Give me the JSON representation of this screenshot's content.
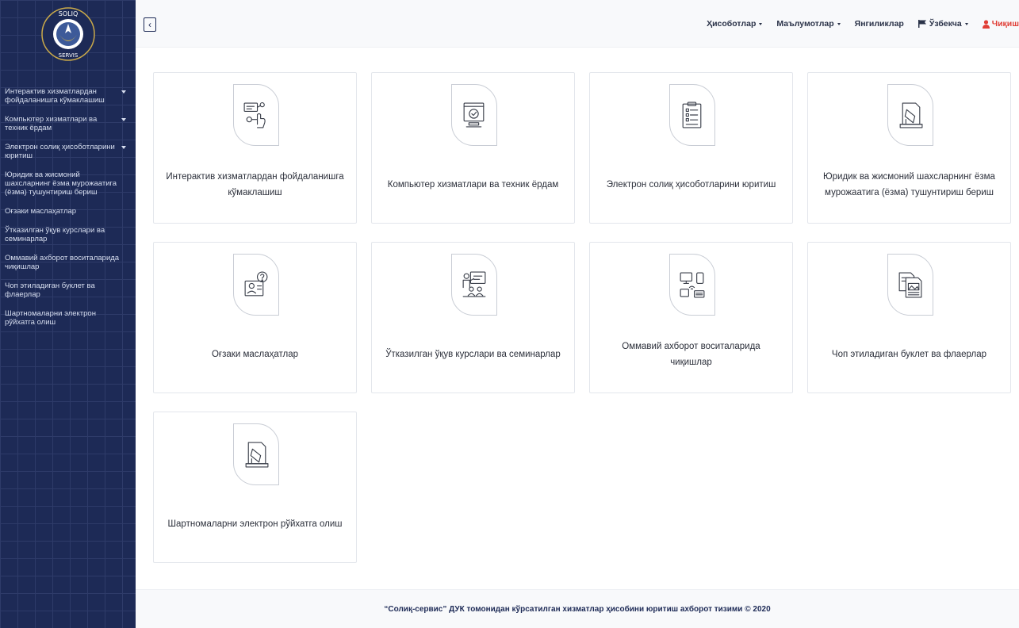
{
  "sidebar": {
    "logo": {
      "top_text": "SOLIQ",
      "bottom_text": "SERVIS"
    },
    "items": [
      {
        "label": "Интерактив хизматлардан фойдаланишга кўмаклашиш",
        "has_submenu": true
      },
      {
        "label": "Компьютер хизматлари ва техник ёрдам",
        "has_submenu": true
      },
      {
        "label": "Электрон солиқ ҳисоботларини юритиш",
        "has_submenu": true
      },
      {
        "label": "Юридик ва жисмоний шахсларнинг ёзма мурожаатига (ёзма) тушунтириш бериш",
        "has_submenu": false
      },
      {
        "label": "Оғзаки маслаҳатлар",
        "has_submenu": false
      },
      {
        "label": "Ўтказилган ўқув курслари ва семинарлар",
        "has_submenu": false
      },
      {
        "label": "Оммавий ахборот воситаларида чиқишлар",
        "has_submenu": false
      },
      {
        "label": "Чоп этиладиган буклет ва флаерлар",
        "has_submenu": false
      },
      {
        "label": "Шартномаларни электрон рўйхатга олиш",
        "has_submenu": false
      }
    ]
  },
  "topbar": {
    "toggle_icon": "chevron-left-icon",
    "menu": {
      "reports": "Ҳисоботлар",
      "info": "Маълумотлар",
      "news": "Янгиликлар",
      "language": "Ўзбекча",
      "logout": "Чиқиш"
    }
  },
  "cards": [
    {
      "title": "Интерактив хизматлардан фойдаланишга кўмаклашиш",
      "icon": "interactive-touch-icon"
    },
    {
      "title": "Компьютер хизматлари ва техник ёрдам",
      "icon": "monitor-check-icon"
    },
    {
      "title": "Электрон солиқ ҳисоботларини юритиш",
      "icon": "checklist-clipboard-icon"
    },
    {
      "title": "Юридик ва жисмоний шахсларнинг ёзма мурожаатига (ёзма) тушунтириш бериш",
      "icon": "document-write-icon"
    },
    {
      "title": "Оғзаки маслаҳатлар",
      "icon": "consultant-question-icon"
    },
    {
      "title": "Ўтказилган ўқув курслари ва семинарлар",
      "icon": "seminar-presentation-icon"
    },
    {
      "title": "Оммавий ахборот воситаларида чиқишлар",
      "icon": "media-devices-icon"
    },
    {
      "title": "Чоп этиладиган буклет ва флаерлар",
      "icon": "booklet-flyer-icon"
    },
    {
      "title": "Шартномаларни электрон рўйхатга олиш",
      "icon": "contract-register-icon"
    }
  ],
  "footer": {
    "text": "“Солиқ-сервис” ДУК томонидан кўрсатилган хизматлар ҳисобини юритиш ахборот тизими © 2020"
  },
  "colors": {
    "sidebar_bg": "#1d2a56",
    "logout": "#e03e36",
    "text_dark": "#2b2f3a"
  }
}
